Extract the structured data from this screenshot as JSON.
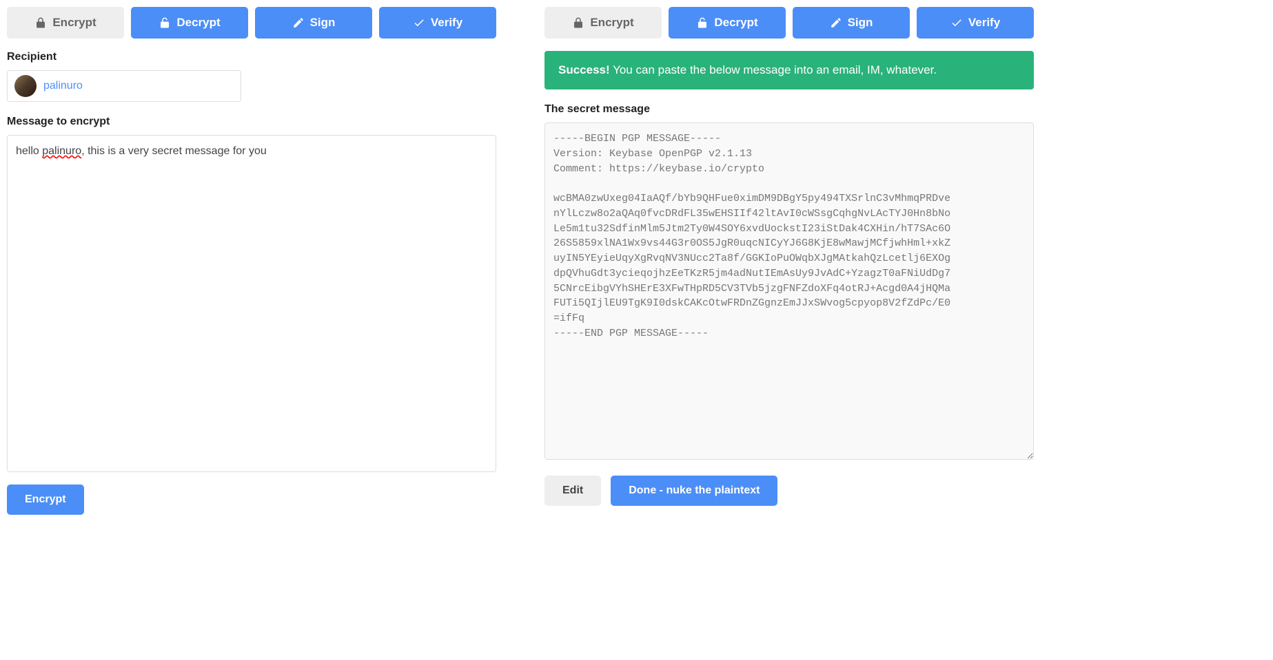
{
  "left": {
    "tabs": {
      "encrypt": "Encrypt",
      "decrypt": "Decrypt",
      "sign": "Sign",
      "verify": "Verify"
    },
    "recipient_label": "Recipient",
    "recipient_name": "palinuro",
    "message_label": "Message to encrypt",
    "message_prefix": "hello ",
    "message_spelled": "palinuro",
    "message_suffix": ", this is a very secret message for you",
    "encrypt_btn": "Encrypt"
  },
  "right": {
    "tabs": {
      "encrypt": "Encrypt",
      "decrypt": "Decrypt",
      "sign": "Sign",
      "verify": "Verify"
    },
    "alert_strong": "Success!",
    "alert_rest": " You can paste the below message into an email, IM, whatever.",
    "secret_label": "The secret message",
    "secret_body": "-----BEGIN PGP MESSAGE-----\nVersion: Keybase OpenPGP v2.1.13\nComment: https://keybase.io/crypto\n\nwcBMA0zwUxeg04IaAQf/bYb9QHFue0ximDM9DBgY5py494TXSrlnC3vMhmqPRDve\nnYlLczw8o2aQAq0fvcDRdFL35wEHSIIf42ltAvI0cWSsgCqhgNvLAcTYJ0Hn8bNo\nLe5m1tu32SdfinMlm5Jtm2Ty0W4SOY6xvdUockstI23iStDak4CXHin/hT7SAc6O\n26S5859xlNA1Wx9vs44G3r0OS5JgR0uqcNICyYJ6G8KjE8wMawjMCfjwhHml+xkZ\nuyIN5YEyieUqyXgRvqNV3NUcc2Ta8f/GGKIoPuOWqbXJgMAtkahQzLcetlj6EXOg\ndpQVhuGdt3ycieqojhzEeTKzR5jm4adNutIEmAsUy9JvAdC+YzagzT0aFNiUdDg7\n5CNrcEibgVYhSHErE3XFwTHpRD5CV3TVb5jzgFNFZdoXFq4otRJ+Acgd0A4jHQMa\nFUTi5QIjlEU9TgK9I0dskCAKcOtwFRDnZGgnzEmJJxSWvog5cpyop8V2fZdPc/E0\n=ifFq\n-----END PGP MESSAGE-----",
    "edit_btn": "Edit",
    "done_btn": "Done - nuke the plaintext"
  }
}
